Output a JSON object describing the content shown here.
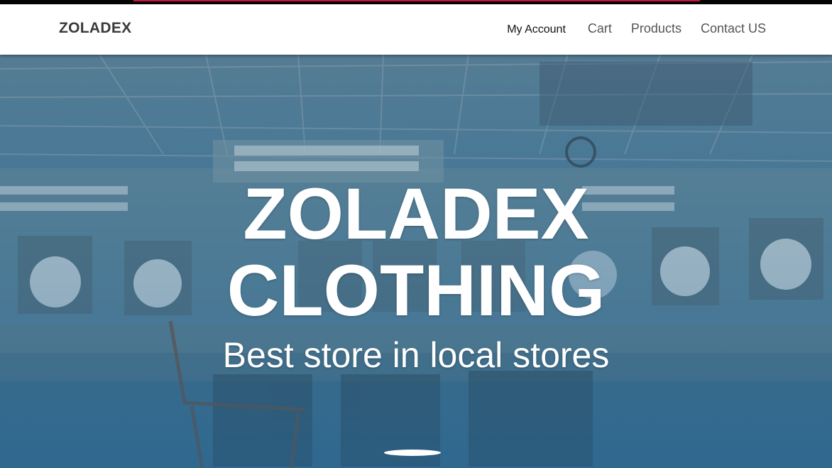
{
  "header": {
    "brand": "ZOLADEX",
    "nav": [
      {
        "label": "My Account"
      },
      {
        "label": "Cart"
      },
      {
        "label": "Products"
      },
      {
        "label": "Contact US"
      }
    ]
  },
  "hero": {
    "title_line1": "ZOLADEX",
    "title_line2": "CLOTHING",
    "tagline": "Best store in local stores",
    "background": "abandoned-control-room-photo"
  },
  "colors": {
    "accent": "#c0193f",
    "overlay": "#336e95",
    "text": "#ffffff"
  }
}
